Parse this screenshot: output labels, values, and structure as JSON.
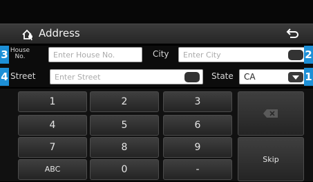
{
  "header": {
    "title": "Address"
  },
  "badges": [
    "1",
    "2",
    "3",
    "4"
  ],
  "form": {
    "house_label_line1": "House",
    "house_label_line2": "No.",
    "house_placeholder": "Enter House No.",
    "city_label": "City",
    "city_placeholder": "Enter City",
    "street_label": "Street",
    "street_placeholder": "Enter Street",
    "state_label": "State",
    "state_value": "CA"
  },
  "keypad": {
    "keys": [
      "1",
      "2",
      "3",
      "4",
      "5",
      "6",
      "7",
      "8",
      "9",
      "ABC",
      "0",
      "-"
    ],
    "skip": "Skip"
  }
}
